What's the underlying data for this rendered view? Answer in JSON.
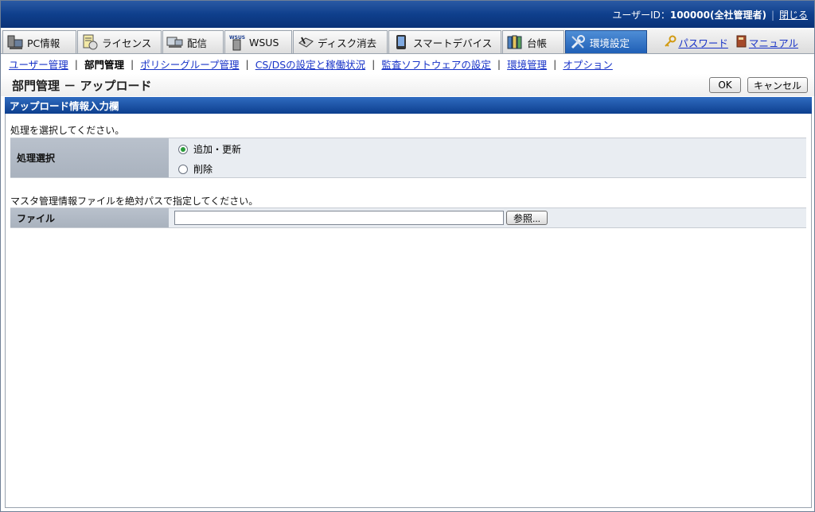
{
  "header": {
    "user_label": "ユーザーID：",
    "user_id": "100000(全社管理者)",
    "close_link": "閉じる"
  },
  "tabs": [
    {
      "label": "PC情報",
      "icon": "pc-icon"
    },
    {
      "label": "ライセンス",
      "icon": "license-icon"
    },
    {
      "label": "配信",
      "icon": "delivery-icon"
    },
    {
      "label": "WSUS",
      "icon": "wsus-icon"
    },
    {
      "label": "ディスク消去",
      "icon": "disk-erase-icon"
    },
    {
      "label": "スマートデバイス",
      "icon": "smartphone-icon"
    },
    {
      "label": "台帳",
      "icon": "ledger-icon"
    },
    {
      "label": "環境設定",
      "icon": "tools-icon",
      "active": true
    }
  ],
  "wsus_icon_text": "WSUS",
  "right_links": {
    "password": "パスワード",
    "manual": "マニュアル"
  },
  "subnav": [
    "ユーザー管理",
    "部門管理",
    "ポリシーグループ管理",
    "CS/DSの設定と稼働状況",
    "監査ソフトウェアの設定",
    "環境管理",
    "オプション"
  ],
  "page": {
    "title": "部門管理 － アップロード",
    "ok_label": "OK",
    "cancel_label": "キャンセル",
    "section_title": "アップロード情報入力欄"
  },
  "process": {
    "instruction": "処理を選択してください。",
    "label": "処理選択",
    "options": [
      "追加・更新",
      "削除"
    ],
    "selected": "追加・更新"
  },
  "file": {
    "instruction": "マスタ管理情報ファイルを絶対パスで指定してください。",
    "label": "ファイル",
    "value": "",
    "browse_label": "参照..."
  },
  "colors": {
    "header": "#0f3f8c",
    "active_tab": "#1f5fb6",
    "link": "#1833c8"
  }
}
